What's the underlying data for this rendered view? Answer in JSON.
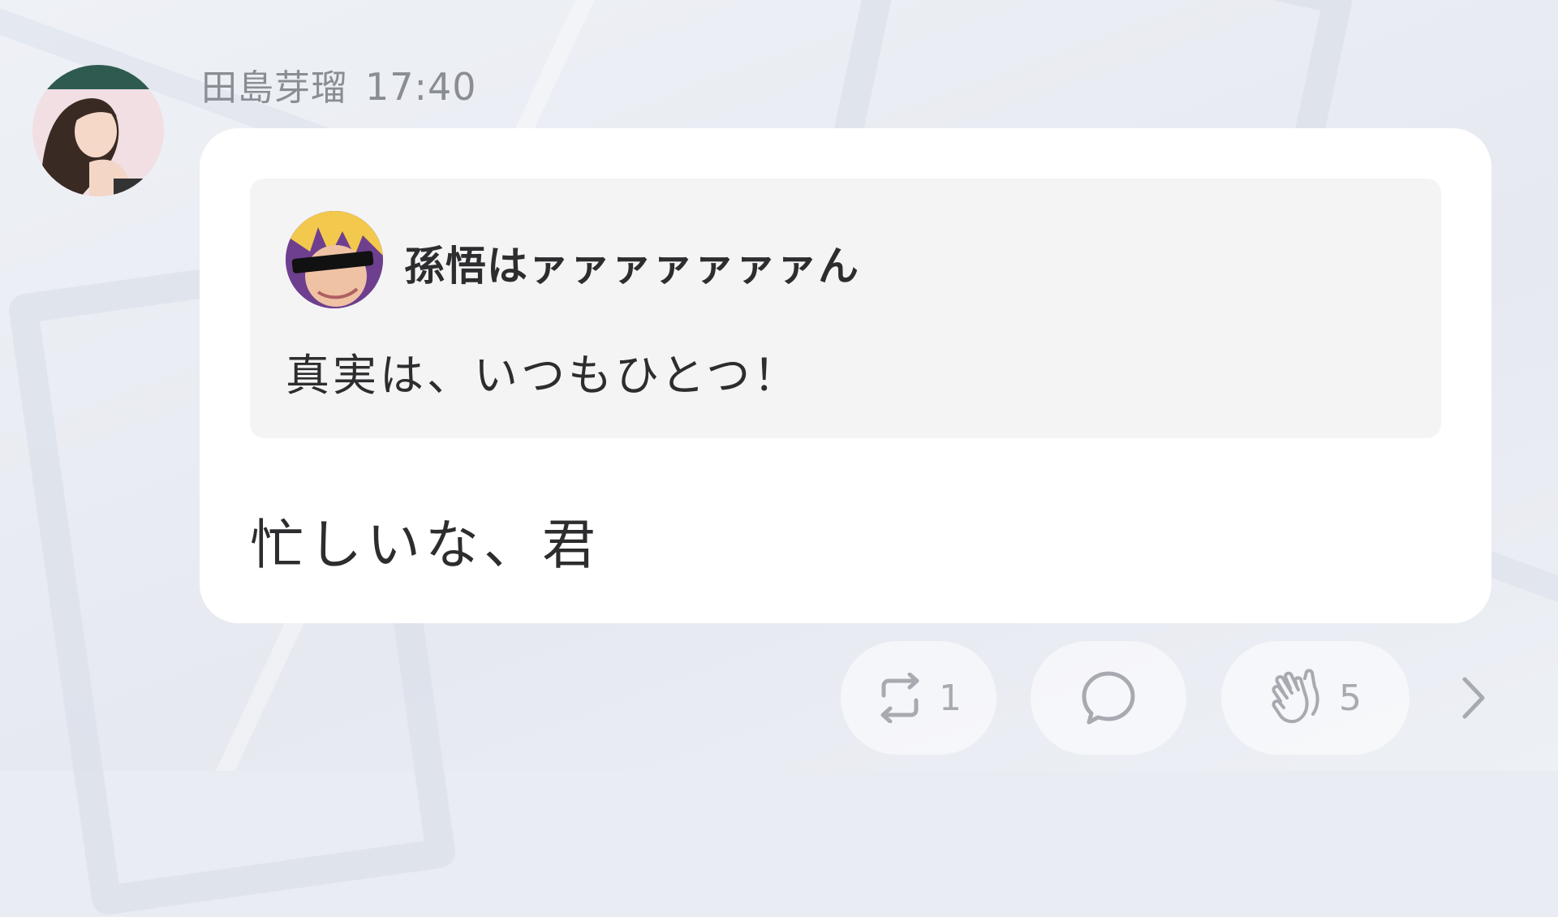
{
  "post": {
    "author": "田島芽瑠",
    "time": "17:40"
  },
  "quote": {
    "author": "孫悟はァァァァァァァん",
    "text": "真実は、いつもひとつ！"
  },
  "message": {
    "text": "忙しいな、君"
  },
  "actions": {
    "repost_count": "1",
    "clap_count": "5"
  },
  "icons": {
    "repost": "repost-icon",
    "comment": "comment-icon",
    "clap": "clap-icon",
    "more": "chevron-right-icon"
  },
  "colors": {
    "background": "#e9ecf2",
    "bubble": "#ffffff",
    "quote_background": "#f4f4f5",
    "meta_text": "#8a8d93",
    "body_text": "#2d2d2f",
    "action_icon": "#a7aab0"
  }
}
